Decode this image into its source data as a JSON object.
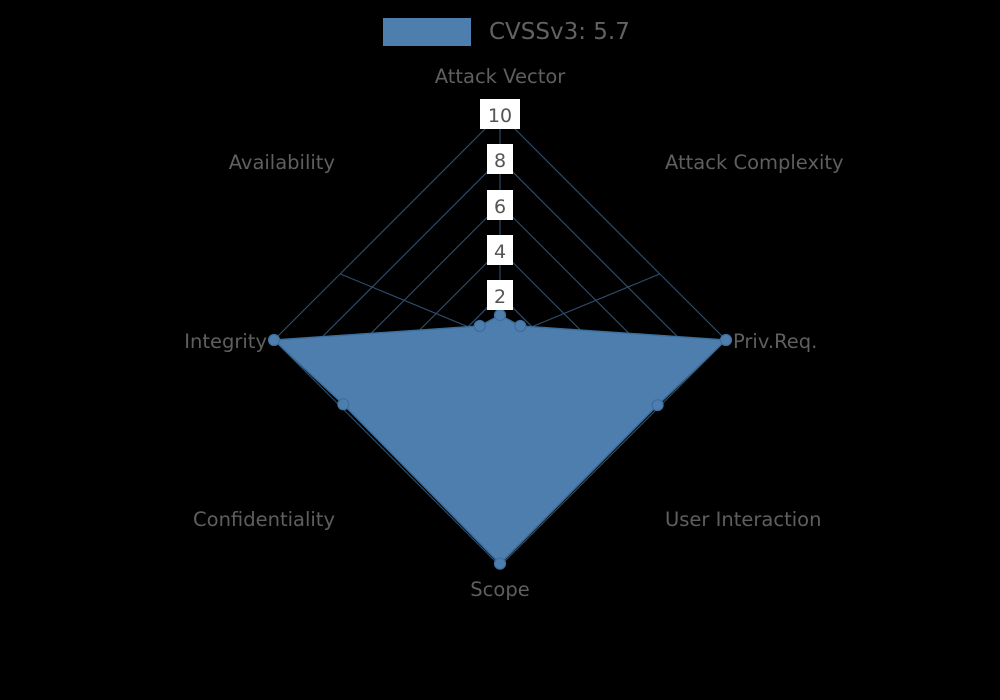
{
  "legend": {
    "label": "CVSSv3: 5.7",
    "swatch_color": "#4e7eae"
  },
  "colors": {
    "background": "#000000",
    "series_fill": "#4e7eae",
    "series_stroke": "#3c6f9e",
    "grid": "#2f4f6d",
    "text": "#5f5f5f",
    "tick_text": "#555555",
    "tick_label_bg": "#ffffff"
  },
  "axis_titles": {
    "attack_vector": "Attack Vector",
    "attack_complexity": "Attack Complexity",
    "priv_req": "Priv.Req.",
    "user_interaction": "User Interaction",
    "scope": "Scope",
    "confidentiality": "Confidentiality",
    "integrity": "Integrity",
    "availability": "Availability"
  },
  "ticks": {
    "t10": "10",
    "t8": "8",
    "t6": "6",
    "t4": "4",
    "t2": "2"
  },
  "chart_data": {
    "type": "radar",
    "title": "",
    "legend_position": "top-center",
    "grid": true,
    "rlim": [
      0,
      10
    ],
    "rticks": [
      2,
      4,
      6,
      8,
      10
    ],
    "categories": [
      "Attack Vector",
      "Attack Complexity",
      "Priv.Req.",
      "User Interaction",
      "Scope",
      "Confidentiality",
      "Integrity",
      "Availability"
    ],
    "series": [
      {
        "name": "CVSSv3: 5.7",
        "values": [
          1.1,
          0.9,
          10.0,
          9.9,
          9.9,
          9.9,
          10.0,
          0.9
        ],
        "color": "#4e7eae"
      }
    ]
  }
}
